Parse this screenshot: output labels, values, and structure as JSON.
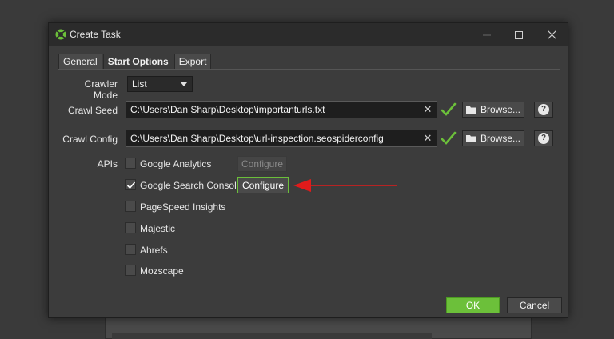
{
  "window": {
    "title": "Create Task"
  },
  "tabs": [
    {
      "label": "General",
      "active": false
    },
    {
      "label": "Start Options",
      "active": true
    },
    {
      "label": "Export",
      "active": false
    }
  ],
  "form": {
    "crawler_mode": {
      "label": "Crawler Mode",
      "value": "List"
    },
    "crawl_seed": {
      "label": "Crawl Seed",
      "value": "C:\\Users\\Dan Sharp\\Desktop\\importanturls.txt",
      "browse_label": "Browse...",
      "help": "?"
    },
    "crawl_config": {
      "label": "Crawl Config",
      "value": "C:\\Users\\Dan Sharp\\Desktop\\url-inspection.seospiderconfig",
      "browse_label": "Browse...",
      "help": "?"
    },
    "apis_label": "APIs",
    "apis": [
      {
        "label": "Google Analytics",
        "checked": false,
        "configure": "Configure",
        "configure_enabled": false
      },
      {
        "label": "Google Search Console",
        "checked": true,
        "configure": "Configure",
        "configure_enabled": true
      },
      {
        "label": "PageSpeed Insights",
        "checked": false
      },
      {
        "label": "Majestic",
        "checked": false
      },
      {
        "label": "Ahrefs",
        "checked": false
      },
      {
        "label": "Mozscape",
        "checked": false
      }
    ]
  },
  "footer": {
    "ok_label": "OK",
    "cancel_label": "Cancel"
  },
  "colors": {
    "accent_green": "#6cc03a",
    "annotation_arrow": "#e01b1b"
  }
}
